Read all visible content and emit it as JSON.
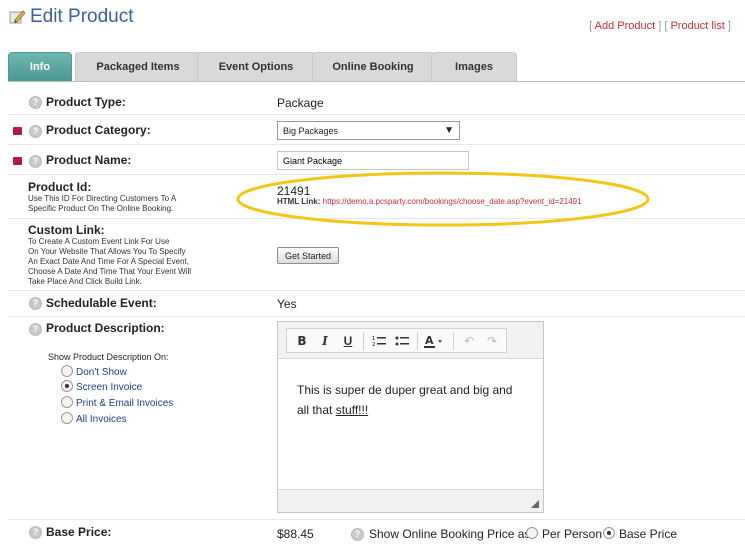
{
  "header": {
    "title": "Edit Product",
    "links": {
      "open": "[ ",
      "add": "Add Product",
      "sep": " ] [ ",
      "list": "Product list",
      "close": " ]"
    }
  },
  "tabs": [
    "Info",
    "Packaged Items",
    "Event Options",
    "Online Booking",
    "Images"
  ],
  "fields": {
    "product_type": {
      "label": "Product Type:",
      "value": "Package"
    },
    "product_category": {
      "label": "Product Category:",
      "value": "Big Packages"
    },
    "product_name": {
      "label": "Product Name:",
      "value": "Giant Package"
    },
    "product_id": {
      "label": "Product Id:",
      "desc_1": "Use This ID For Directing Customers To A",
      "desc_2": "Specific Product On The Online Booking.",
      "value": "21491",
      "link_label": "HTML Link:",
      "link_url": "https://demo.a.pcsparty.com/bookings/choose_date.asp?event_id=21491"
    },
    "custom_link": {
      "label": "Custom Link:",
      "desc_1": "To Create A Custom Event Link For Use",
      "desc_2": "On Your Website That Allows You To Specify",
      "desc_3": "An Exact Date And Time For A Special Event,",
      "desc_4": "Choose A Date And Time That Your Event Will",
      "desc_5": "Take Place And Click Build Link.",
      "button": "Get Started"
    },
    "schedulable": {
      "label": "Schedulable Event:",
      "value": "Yes"
    },
    "description": {
      "label": "Product Description:",
      "show_on_label": "Show Product Description On:",
      "options": [
        "Don't Show",
        "Screen Invoice",
        "Print & Email Invoices",
        "All Invoices"
      ],
      "selected": "Screen Invoice",
      "content_1": "This is super de duper great and big and",
      "content_2": "all that ",
      "content_link": "stuff!!!"
    },
    "base_price": {
      "label": "Base Price:",
      "value": "$88.45",
      "show_label": "Show Online Booking Price as:",
      "option_1": "Per Person",
      "option_2": "Base Price",
      "selected": "Base Price"
    }
  },
  "help_glyph": "?",
  "colors": {
    "title": "#3a5f9e",
    "active_tab": "#4b9994",
    "required": "#b5174b",
    "link": "#c0303c",
    "highlight": "#f5c518"
  }
}
